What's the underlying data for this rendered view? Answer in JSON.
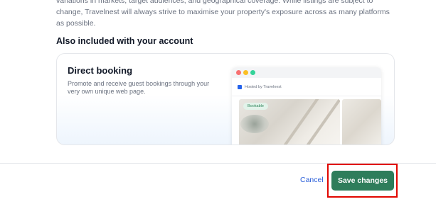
{
  "intro": {
    "text": "variations in markets, target audiences, and geographical coverage. While listings are subject to change, Travelnest will always strive to maximise your property's exposure across as many platforms as possible."
  },
  "section": {
    "title": "Also included with your account"
  },
  "card": {
    "title": "Direct booking",
    "description": "Promote and receive guest bookings through your very own unique web page.",
    "preview": {
      "hosted_by": "Hosted by Travelnest",
      "badge": "Bookable"
    }
  },
  "footer": {
    "cancel_label": "Cancel",
    "save_label": "Save changes",
    "save_color": "#2e7d5b",
    "highlight_color": "#e10600"
  }
}
